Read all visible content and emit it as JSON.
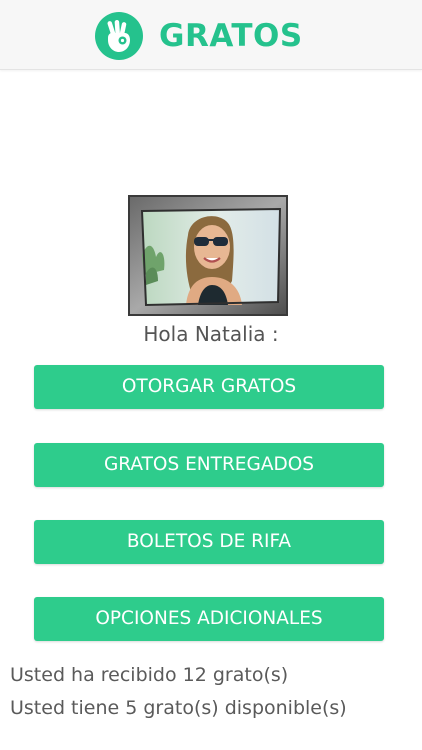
{
  "header": {
    "logo_icon": "ok-hand-gesture-icon",
    "app_name": "GRATOS",
    "brand_color": "#25c28d"
  },
  "profile": {
    "avatar_icon": "user-photo",
    "greeting": "Hola Natalia :"
  },
  "menu": {
    "button_color": "#2ecc8c",
    "otorgar": "OTORGAR GRATOS",
    "entregados": "GRATOS ENTREGADOS",
    "boletos": "BOLETOS DE RIFA",
    "opciones": "OPCIONES ADICIONALES"
  },
  "status": {
    "received": "Usted ha recibido 12 grato(s)",
    "available": "Usted tiene 5 grato(s) disponible(s)"
  }
}
